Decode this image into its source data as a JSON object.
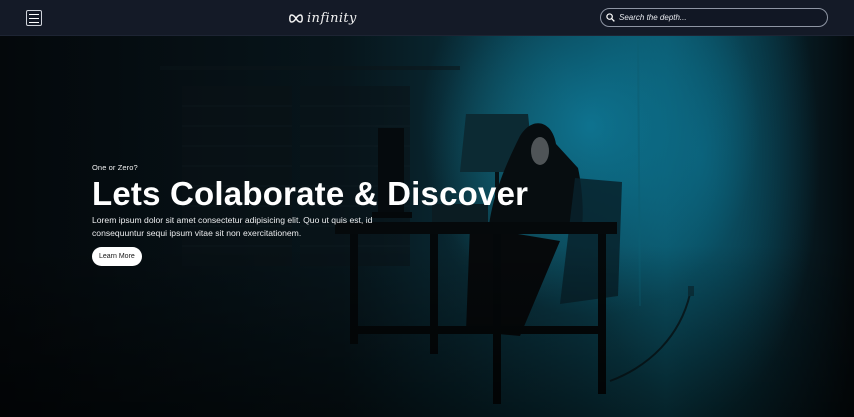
{
  "navbar": {
    "menu_icon": "hamburger-menu-icon",
    "logo": {
      "icon": "infinity-icon",
      "text": "infinity"
    },
    "search": {
      "icon": "search-icon",
      "placeholder": "Search the depth..."
    }
  },
  "hero": {
    "eyebrow": "One or Zero?",
    "headline": "Lets Colaborate & Discover",
    "body": "Lorem ipsum dolor sit amet consectetur adipisicing elit. Quo ut quis est, id consequuntur sequi ipsum vitae sit non exercitationem.",
    "cta_label": "Learn More"
  },
  "colors": {
    "navbar_bg": "#141a27",
    "hero_teal": "#0b4c5c",
    "button_bg": "#ffffff"
  }
}
